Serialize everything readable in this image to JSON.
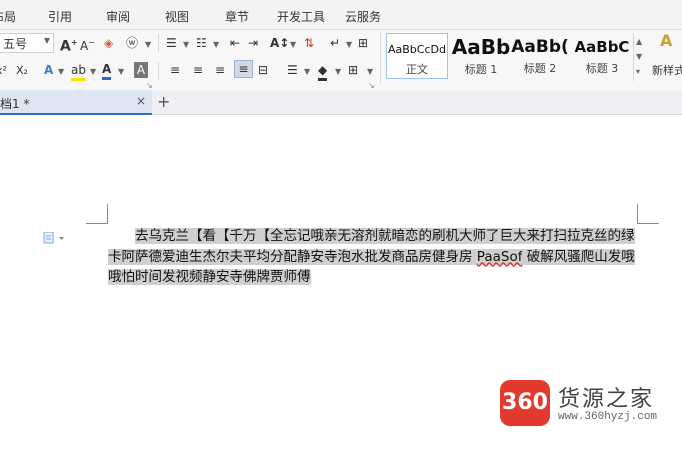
{
  "menu_tabs": [
    "布局",
    "引用",
    "审阅",
    "视图",
    "章节",
    "开发工具",
    "云服务"
  ],
  "font": {
    "size_value": "五号"
  },
  "styles": [
    {
      "sample": "AaBbCcDd",
      "name": "正文"
    },
    {
      "sample": "AaBb",
      "name": "标题 1"
    },
    {
      "sample": "AaBb(",
      "name": "标题 2"
    },
    {
      "sample": "AaBbC",
      "name": "标题 3"
    }
  ],
  "new_style_label": "新样式",
  "doc_tab": {
    "title": "档1 *",
    "close": "×",
    "new": "+"
  },
  "document": {
    "text_before": "去乌克兰【看【千万【全忘记哦亲无溶剂就暗恋的刷机大师了巨大来打扫拉克丝的绿卡阿萨德爱迪生杰尔夫平均分配静安寺泡水批发商品房健身房 ",
    "misspelled": "PaaSof",
    "text_after": " 破解风骚爬山发哦哦怕时间发视频静安寺佛牌贾师傅"
  },
  "watermark": {
    "logo": "360",
    "name": "货源之家",
    "url": "www.360hyzj.com"
  },
  "colors": {
    "accent": "#2f6fc3",
    "highlight": "#cfcfcf",
    "logo_red": "#e23a2e"
  }
}
